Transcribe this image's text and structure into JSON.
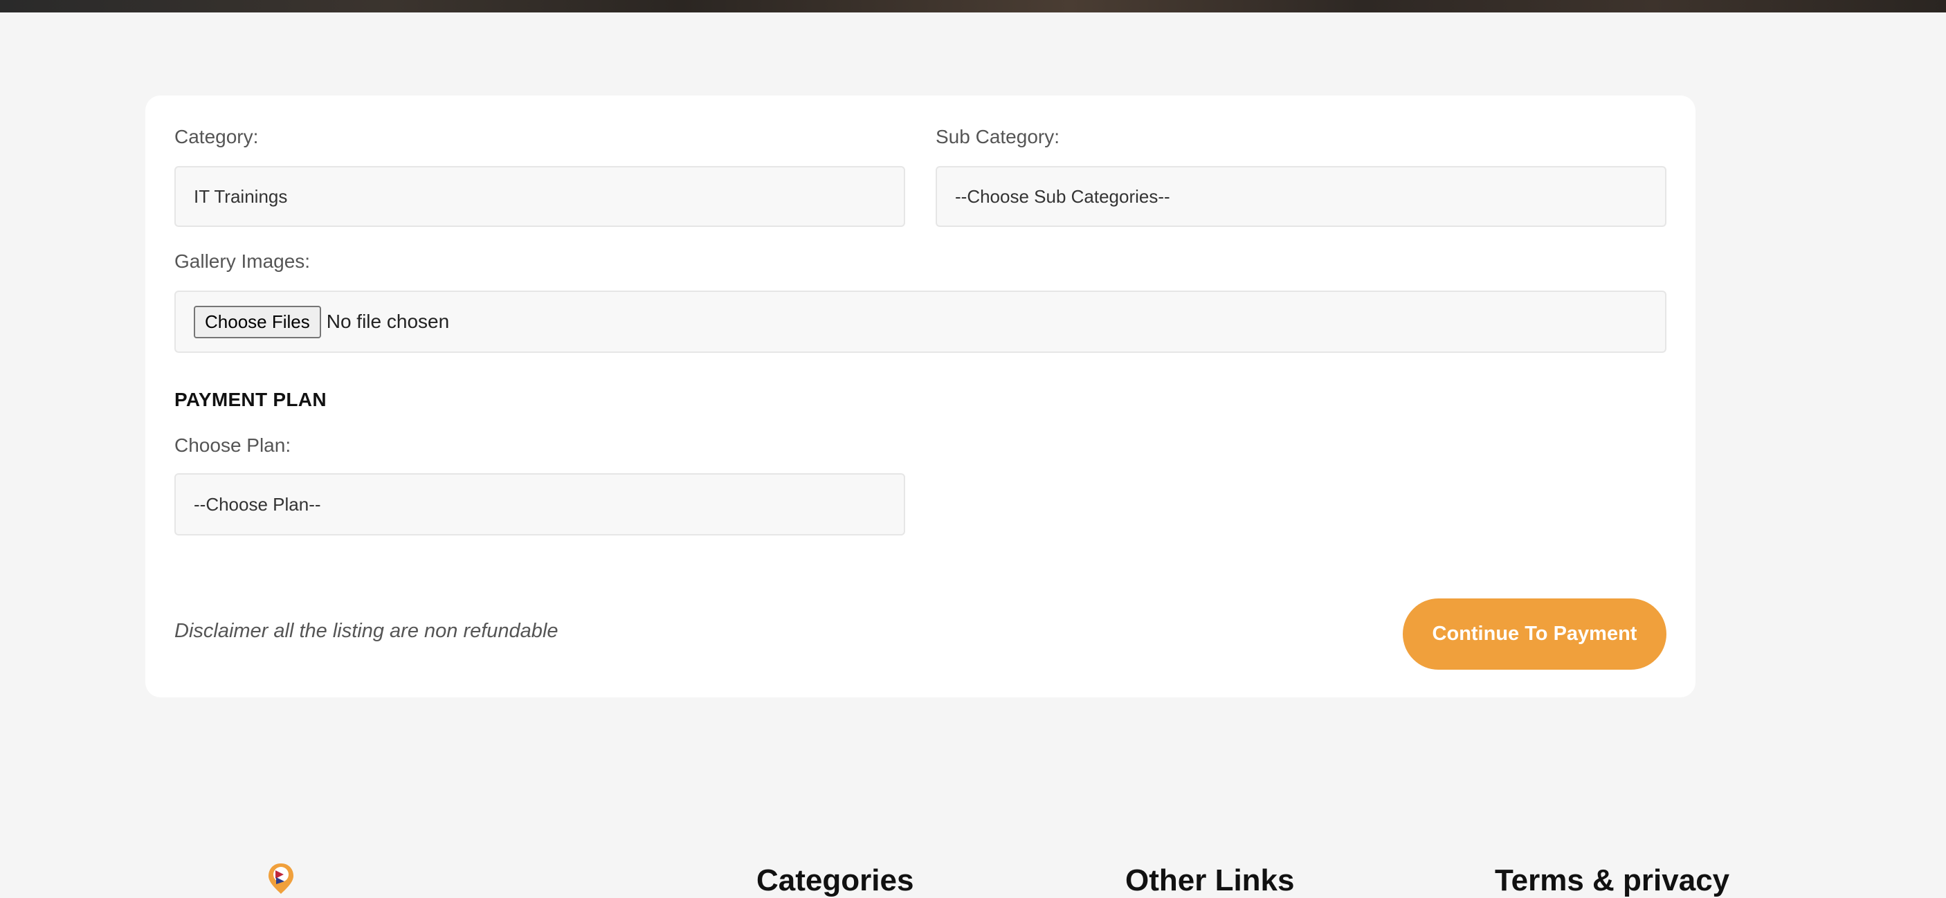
{
  "form": {
    "category": {
      "label": "Category:",
      "value": "IT Trainings"
    },
    "sub_category": {
      "label": "Sub Category:",
      "value": "--Choose Sub Categories--"
    },
    "gallery": {
      "label": "Gallery Images:",
      "button_label": "Choose Files",
      "status": "No file chosen"
    },
    "payment_plan": {
      "heading": "PAYMENT PLAN",
      "label": "Choose Plan:",
      "value": "--Choose Plan--"
    },
    "disclaimer": "Disclaimer all the listing are non refundable",
    "continue_label": "Continue To Payment"
  },
  "footer": {
    "logo_icon": "map-pin-logo-icon",
    "headings": [
      "Categories",
      "Other Links",
      "Terms & privacy"
    ]
  },
  "colors": {
    "accent": "#f0a03c",
    "background": "#f5f5f5",
    "card": "#ffffff"
  }
}
